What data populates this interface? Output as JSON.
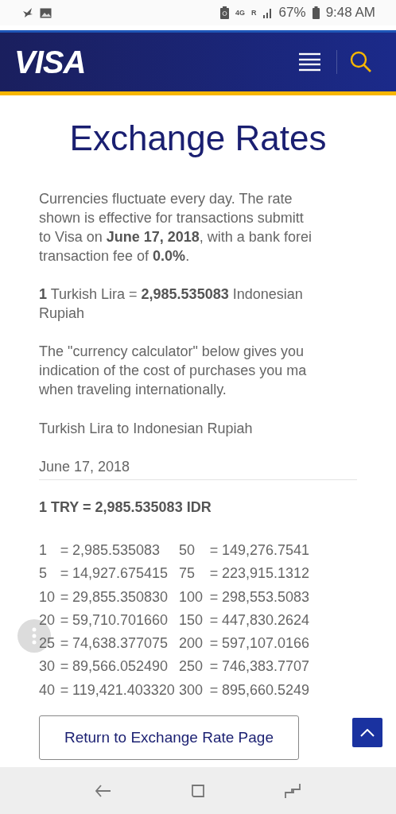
{
  "status_bar": {
    "network": "4G",
    "roaming": "R",
    "battery": "67%",
    "time": "9:48 AM"
  },
  "header": {
    "logo": "VISA"
  },
  "title": "Exchange Rates",
  "intro": [
    "Currencies fluctuate every day. The rate",
    "shown is effective for transactions submitt",
    "to Visa on **June 17, 2018**, with a bank forei",
    "transaction fee of **0.0%**."
  ],
  "rate_statement": [
    "**1** Turkish Lira = **2,985.535083** Indonesian",
    "Rupiah"
  ],
  "calculator_note": [
    "The \"currency calculator\" below gives you",
    "indication of the cost of purchases you ma",
    "when traveling internationally."
  ],
  "conversion_label": "Turkish Lira to Indonesian Rupiah",
  "date": "June 17, 2018",
  "headline_rate": "1 TRY = 2,985.535083 IDR",
  "table": {
    "rows": [
      [
        "1",
        "=",
        "2,985.535083",
        "50",
        "=",
        "149,276.7541"
      ],
      [
        "5",
        "=",
        "14,927.675415",
        "75",
        "=",
        "223,915.1312"
      ],
      [
        "10",
        "=",
        "29,855.350830",
        "100",
        "=",
        "298,553.5083"
      ],
      [
        "20",
        "=",
        "59,710.701660",
        "150",
        "=",
        "447,830.2624"
      ],
      [
        "25",
        "=",
        "74,638.377075",
        "200",
        "=",
        "597,107.0166"
      ],
      [
        "30",
        "=",
        "89,566.052490",
        "250",
        "=",
        "746,383.7707"
      ],
      [
        "40",
        "=",
        "119,421.403320",
        "300",
        "=",
        "895,660.5249"
      ]
    ]
  },
  "return_button": "Return to Exchange Rate Page"
}
